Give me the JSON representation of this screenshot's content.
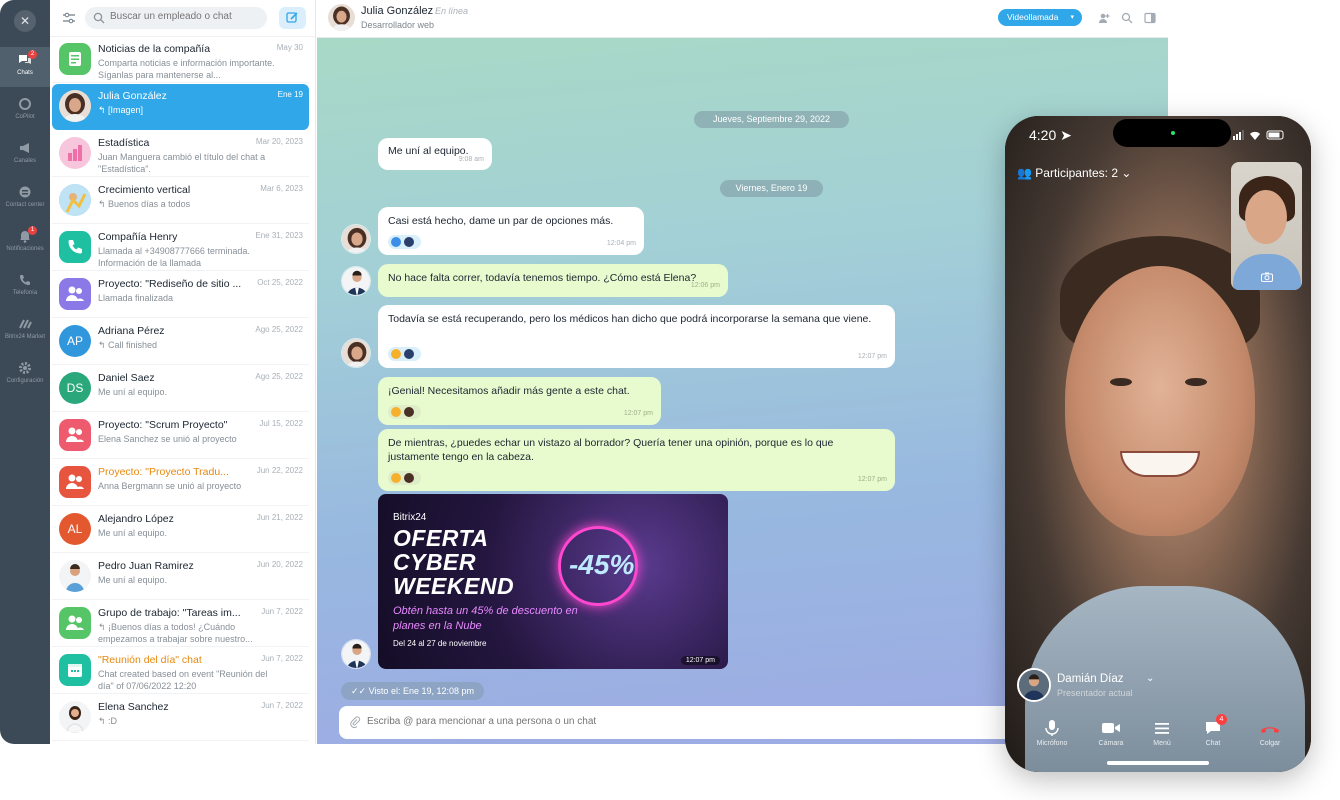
{
  "rail": {
    "chats_badge": "2",
    "notif_badge": "1",
    "items": [
      {
        "label": "Chats"
      },
      {
        "label": "CoPilot"
      },
      {
        "label": "Canales"
      },
      {
        "label": "Contact center"
      },
      {
        "label": "Notificaciones"
      },
      {
        "label": "Telefonía"
      },
      {
        "label": "Bitrix24 Market"
      },
      {
        "label": "Configuración"
      }
    ]
  },
  "list": {
    "search_placeholder": "Buscar un empleado o chat",
    "items": [
      {
        "name": "Noticias de la compañía",
        "date": "May 30",
        "preview": "Comparta noticias e información importante. Síganlas para mantenerse al..."
      },
      {
        "name": "Julia González",
        "date": "Ene 19",
        "preview": "↰ [Imagen]"
      },
      {
        "name": "Estadística",
        "date": "Mar 20, 2023",
        "preview": "Juan Manguera cambió el título del chat a \"Estadística\"."
      },
      {
        "name": "Crecimiento vertical",
        "date": "Mar 6, 2023",
        "preview": "↰ Buenos días a todos"
      },
      {
        "name": "Compañía Henry",
        "date": "Ene 31, 2023",
        "preview": "Llamada al +34908777666 terminada. Información de la llamada"
      },
      {
        "name": "Proyecto: \"Rediseño de sitio ...",
        "date": "Oct 25, 2022",
        "preview": "Llamada finalizada"
      },
      {
        "name": "Adriana Pérez",
        "date": "Ago 25, 2022",
        "preview": "↰ Call finished",
        "initials": "AP"
      },
      {
        "name": "Daniel Saez",
        "date": "Ago 25, 2022",
        "preview": "Me uní al equipo.",
        "initials": "DS"
      },
      {
        "name": "Proyecto: \"Scrum Proyecto\"",
        "date": "Jul 15, 2022",
        "preview": "Elena Sanchez se unió al proyecto"
      },
      {
        "name": "Proyecto: \"Proyecto Tradu...",
        "date": "Jun 22, 2022",
        "preview": "Anna Bergmann se unió al proyecto"
      },
      {
        "name": "Alejandro López",
        "date": "Jun 21, 2022",
        "preview": "Me uní al equipo.",
        "initials": "AL"
      },
      {
        "name": "Pedro Juan Ramirez",
        "date": "Jun 20, 2022",
        "preview": "Me uní al equipo."
      },
      {
        "name": "Grupo de trabajo: \"Tareas im...",
        "date": "Jun 7, 2022",
        "preview": "↰ ¡Buenos días a todos! ¿Cuándo empezamos a trabajar sobre nuestro..."
      },
      {
        "name": "\"Reunión del día\" chat",
        "date": "Jun 7, 2022",
        "preview": "Chat created based on event \"Reunión del día\" of 07/06/2022 12:20"
      },
      {
        "name": "Elena Sanchez",
        "date": "Jun 7, 2022",
        "preview": "↰ :D"
      }
    ]
  },
  "chat": {
    "name": "Julia González",
    "status": "En línea",
    "role": "Desarrollador web",
    "video_btn": "Videollamada",
    "date1": "Jueves, Septiembre 29, 2022",
    "date2": "Viernes, Enero 19",
    "messages": [
      {
        "text": "Me uní al equipo.",
        "time": "9:08 am"
      },
      {
        "text": "Casi está hecho, dame un par de opciones más.",
        "time": "12:04 pm"
      },
      {
        "text": "No hace falta correr, todavía tenemos tiempo. ¿Cómo está Elena?",
        "time": "12:06 pm"
      },
      {
        "text": "Todavía se está recuperando, pero los médicos han dicho que podrá incorporarse la semana que viene.",
        "time": "12:07 pm"
      },
      {
        "text": "¡Genial! Necesitamos añadir más gente a este chat.",
        "time": "12:07 pm"
      },
      {
        "text": "De mientras, ¿puedes echar un vistazo al borrador? Quería tener una opinión, porque es lo que justamente tengo en la cabeza.",
        "time": "12:07 pm"
      }
    ],
    "promo": {
      "brand": "Bitrix24",
      "line1": "OFERTA",
      "line2": "CYBER",
      "line3": "WEEKEND",
      "discount": "-45%",
      "sub": "Obtén hasta un 45% de descuento en planes en la Nube",
      "dates": "Del 24 al 27 de noviembre",
      "time": "12:07 pm"
    },
    "seen": "Visto el: Ene 19, 12:08 pm",
    "input_placeholder": "Escriba @ para mencionar a una persona o un chat"
  },
  "phone": {
    "time": "4:20",
    "participants": "Participantes: 2",
    "caller_name": "Damián Díaz",
    "caller_role": "Presentador actual",
    "chat_badge": "4",
    "controls": [
      "Micrófono",
      "Cámara",
      "Menú",
      "Chat",
      "Colgar"
    ]
  },
  "colors": {
    "accent": "#2fa7e8",
    "own_bubble": "#e8fbcf",
    "rail": "#3c4a57",
    "hangup": "#ff3f3f"
  }
}
